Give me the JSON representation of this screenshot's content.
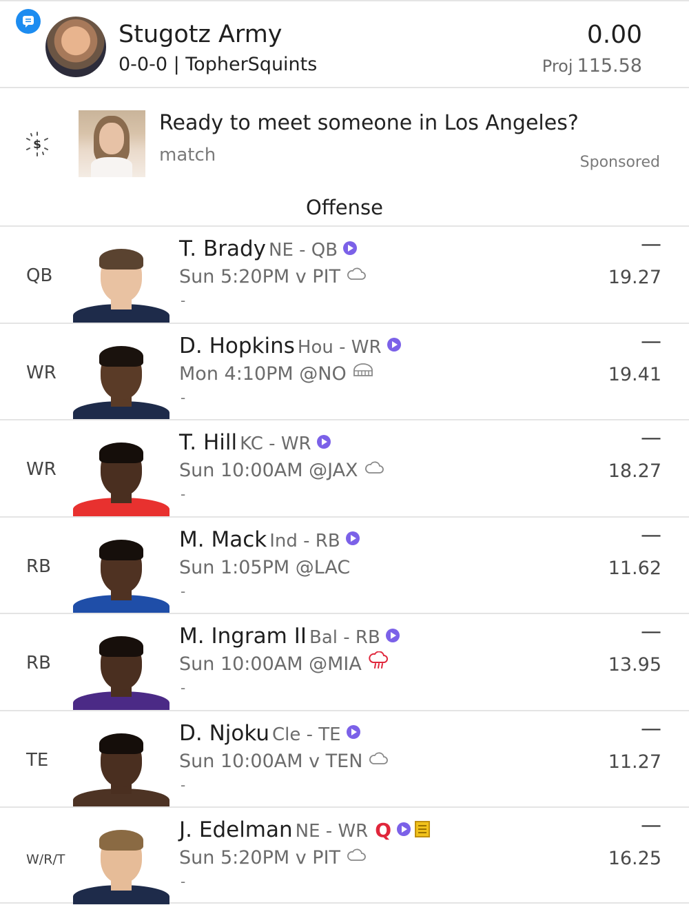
{
  "header": {
    "team_name": "Stugotz Army",
    "record_owner": "0-0-0 | TopherSquints",
    "score": "0.00",
    "proj_label": "Proj",
    "proj_value": "115.58",
    "chat_icon": "chat-bubble-icon",
    "accent_color": "#1d8cf0"
  },
  "ad": {
    "title": "Ready to meet someone in Los Angeles?",
    "brand": "match",
    "sponsored_label": "Sponsored",
    "icon": "dollar-sparkle-icon"
  },
  "section_title": "Offense",
  "players": [
    {
      "pos": "QB",
      "name": "T. Brady",
      "team_pos": "NE - QB",
      "game": "Sun 5:20PM v PIT",
      "weather": "cloud",
      "points": "—",
      "proj": "19.27",
      "note": "-",
      "jersey": "#1e2b4a",
      "skin": "#e9c2a2",
      "hair": "#5a4330"
    },
    {
      "pos": "WR",
      "name": "D. Hopkins",
      "team_pos": "Hou - WR",
      "game": "Mon 4:10PM @NO",
      "weather": "dome",
      "points": "—",
      "proj": "19.41",
      "note": "-",
      "jersey": "#1e2b4a",
      "skin": "#5a3b27",
      "hair": "#1a120d"
    },
    {
      "pos": "WR",
      "name": "T. Hill",
      "team_pos": "KC - WR",
      "game": "Sun 10:00AM @JAX",
      "weather": "cloud",
      "points": "—",
      "proj": "18.27",
      "note": "-",
      "jersey": "#e8312f",
      "skin": "#4a2f20",
      "hair": "#150e0a"
    },
    {
      "pos": "RB",
      "name": "M. Mack",
      "team_pos": "Ind - RB",
      "game": "Sun 1:05PM @LAC",
      "weather": "",
      "points": "—",
      "proj": "11.62",
      "note": "-",
      "jersey": "#1f4ea8",
      "skin": "#4f3222",
      "hair": "#160f0b"
    },
    {
      "pos": "RB",
      "name": "M. Ingram II",
      "team_pos": "Bal - RB",
      "game": "Sun 10:00AM @MIA",
      "weather": "rain",
      "points": "—",
      "proj": "13.95",
      "note": "-",
      "jersey": "#4b2a86",
      "skin": "#4a2f20",
      "hair": "#170f0b"
    },
    {
      "pos": "TE",
      "name": "D. Njoku",
      "team_pos": "Cle - TE",
      "game": "Sun 10:00AM v TEN",
      "weather": "cloud",
      "points": "—",
      "proj": "11.27",
      "note": "-",
      "jersey": "#4d3324",
      "skin": "#4a2f20",
      "hair": "#150e0a"
    },
    {
      "pos": "W/R/T",
      "name": "J. Edelman",
      "team_pos": "NE - WR",
      "status": "Q",
      "game": "Sun 5:20PM v PIT",
      "weather": "cloud",
      "points": "—",
      "proj": "16.25",
      "note": "-",
      "jersey": "#1e2b4a",
      "skin": "#e6bc98",
      "hair": "#8a6a43",
      "has_note": true
    }
  ]
}
